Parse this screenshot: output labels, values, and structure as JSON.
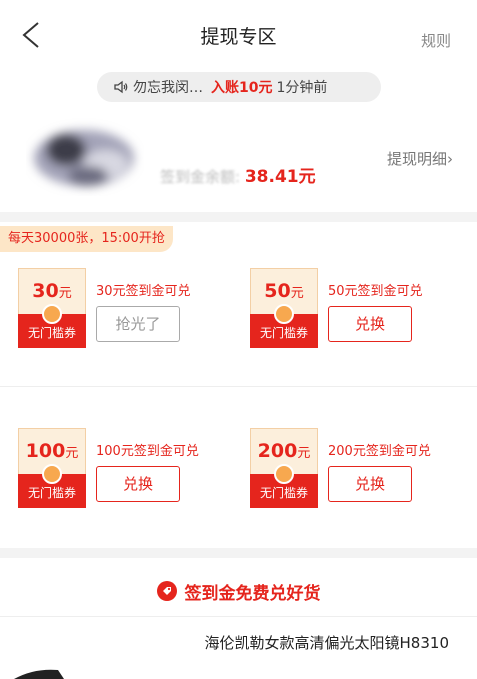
{
  "header": {
    "title": "提现专区",
    "rules_label": "规则",
    "back_icon": "chevron-left-icon"
  },
  "notice": {
    "speaker_icon": "speaker-icon",
    "user": "勿忘我闵…",
    "amount_text": "入账10元",
    "time": "1分钟前"
  },
  "balance": {
    "label": "签到金余额:",
    "value": "38.41元"
  },
  "detail_link": "提现明细",
  "promo_notice": "每天30000张，15:00开抢",
  "coupons": [
    {
      "amount": "30",
      "unit": "元",
      "tag": "无门槛券",
      "desc": "30元签到金可兑",
      "button": "抢光了",
      "sold_out": true
    },
    {
      "amount": "50",
      "unit": "元",
      "tag": "无门槛券",
      "desc": "50元签到金可兑",
      "button": "兑换",
      "sold_out": false
    },
    {
      "amount": "100",
      "unit": "元",
      "tag": "无门槛券",
      "desc": "100元签到金可兑",
      "button": "兑换",
      "sold_out": false
    },
    {
      "amount": "200",
      "unit": "元",
      "tag": "无门槛券",
      "desc": "200元签到金可兑",
      "button": "兑换",
      "sold_out": false
    }
  ],
  "goods": {
    "icon": "tag-icon",
    "title": "签到金免费兑好货"
  },
  "product": {
    "title": "海伦凯勒女款高清偏光太阳镜H8310"
  },
  "colors": {
    "accent": "#e5251d",
    "coupon_bg": "#fcefdc",
    "seal": "#f7a84f",
    "promo_bg": "#fde6c7"
  }
}
